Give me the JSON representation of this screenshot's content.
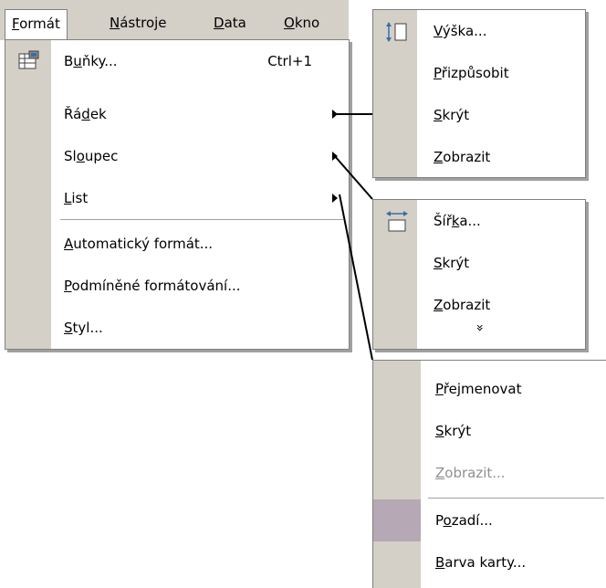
{
  "menubar": {
    "items": [
      {
        "label": "Formát",
        "mnemonic": "F"
      },
      {
        "label": "Nástroje",
        "mnemonic": "N"
      },
      {
        "label": "Data",
        "mnemonic": "D"
      },
      {
        "label": "Okno",
        "mnemonic": "O"
      }
    ]
  },
  "format_menu": {
    "items": [
      {
        "label": "Buňky...",
        "shortcut": "Ctrl+1",
        "icon": "format-cells-icon"
      },
      {
        "label": "Řádek",
        "submenu": true
      },
      {
        "label": "Sloupec",
        "submenu": true
      },
      {
        "label": "List",
        "submenu": true
      },
      {
        "label": "Automatický formát..."
      },
      {
        "label": "Podmíněné formátování..."
      },
      {
        "label": "Styl..."
      }
    ]
  },
  "row_submenu": {
    "items": [
      {
        "label": "Výška...",
        "icon": "row-height-icon"
      },
      {
        "label": "Přizpůsobit"
      },
      {
        "label": "Skrýt"
      },
      {
        "label": "Zobrazit"
      }
    ]
  },
  "column_submenu": {
    "items": [
      {
        "label": "Šířka...",
        "icon": "column-width-icon"
      },
      {
        "label": "Skrýt"
      },
      {
        "label": "Zobrazit"
      }
    ],
    "expand_glyph": "»"
  },
  "sheet_submenu": {
    "items": [
      {
        "label": "Přejmenovat"
      },
      {
        "label": "Skrýt"
      },
      {
        "label": "Zobrazit...",
        "disabled": true
      },
      {
        "label": "Pozadí...",
        "highlighted": true
      },
      {
        "label": "Barva karty..."
      }
    ]
  },
  "colors": {
    "gutter": "#d4d0c8",
    "border": "#808080",
    "highlight": "#b6a8b4",
    "disabled_text": "#909090"
  }
}
